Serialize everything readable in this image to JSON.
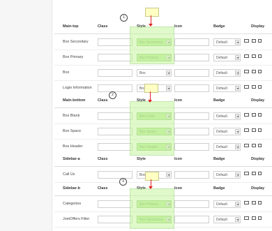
{
  "columns": {
    "class": "Class",
    "style": "Style",
    "icon": "Icon",
    "badge": "Badge",
    "display": "Display"
  },
  "sections": [
    {
      "title": "Main-top",
      "rows": [
        {
          "name": "Box Secondary",
          "style": "Box Secondary",
          "badge": "Default",
          "highlighted": true
        },
        {
          "name": "Box Primary",
          "style": "Box Primary",
          "badge": "Default",
          "highlighted": true
        },
        {
          "name": "Box",
          "style": "Box",
          "badge": "Default",
          "highlighted": false
        },
        {
          "name": "Login Information",
          "style": "Box",
          "badge": "Default",
          "highlighted": false
        }
      ]
    },
    {
      "title": "Main-bottom",
      "rows": [
        {
          "name": "Box Blank",
          "style": "Box Color",
          "badge": "Default",
          "highlighted": true
        },
        {
          "name": "Box Space",
          "style": "Box Space",
          "badge": "Default",
          "highlighted": true
        },
        {
          "name": "Box Header",
          "style": "Box Header",
          "badge": "Default",
          "highlighted": true
        }
      ]
    },
    {
      "title": "Sidebar-a",
      "rows": [
        {
          "name": "Call Us",
          "style": "Box",
          "badge": "Default",
          "highlighted": false
        }
      ]
    },
    {
      "title": "Sidebar-b",
      "rows": [
        {
          "name": "Categories",
          "style": "Box Primary",
          "badge": "Default",
          "highlighted": true
        },
        {
          "name": "JomOffers Filter",
          "style": "Box Secondary",
          "badge": "Default",
          "highlighted": true
        }
      ]
    }
  ],
  "callouts": [
    "1",
    "2",
    "3"
  ],
  "colors": {
    "highlight": "#c7f5a0",
    "arrow": "#e01f1f",
    "note": "#ffffc4"
  },
  "icons": [
    "monitor-icon",
    "tablet-icon",
    "phone-icon"
  ]
}
